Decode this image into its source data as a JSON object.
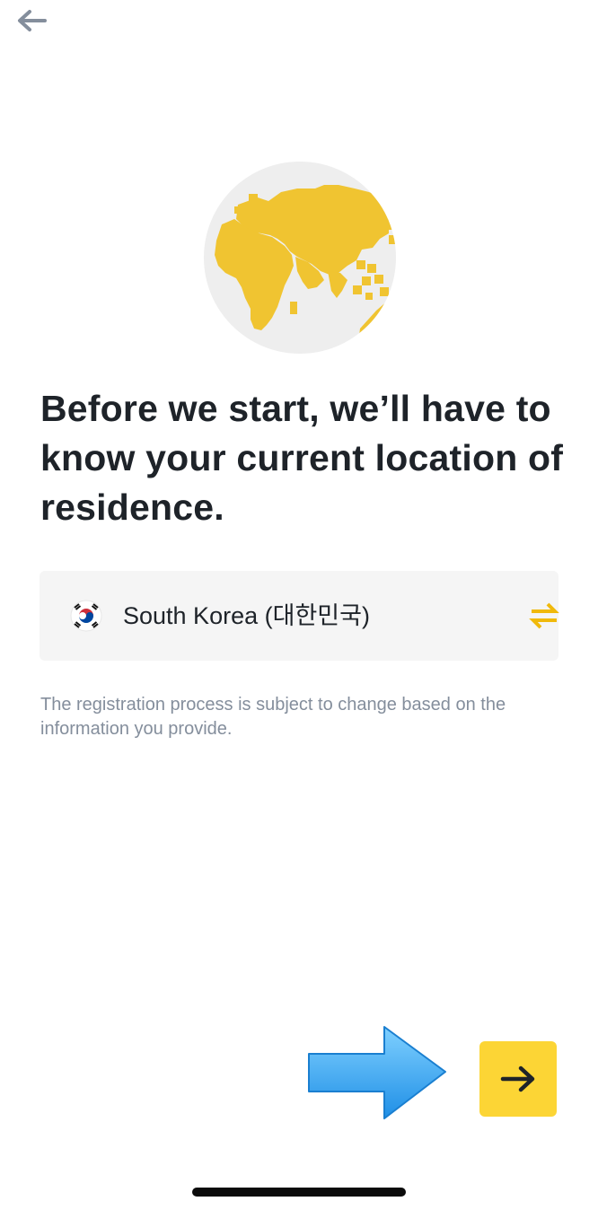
{
  "header": {
    "back_icon": "arrow-left-icon"
  },
  "illustration": {
    "icon": "globe-icon",
    "colors": {
      "land": "#f0c431",
      "background": "#eeeeee"
    }
  },
  "headline": "Before we start, we’ll have to know your current location of residence.",
  "country_selector": {
    "flag_icon": "south-korea-flag-icon",
    "country": "South Korea (대한민국)",
    "swap_icon": "swap-arrows-icon",
    "accent_color": "#f0b90b"
  },
  "note": "The registration process is subject to change based on the information you provide.",
  "next_button": {
    "icon": "arrow-right-icon",
    "color": "#fcd535"
  },
  "annotation": {
    "icon": "blue-pointer-arrow-icon",
    "color": "#3aa8f0"
  }
}
